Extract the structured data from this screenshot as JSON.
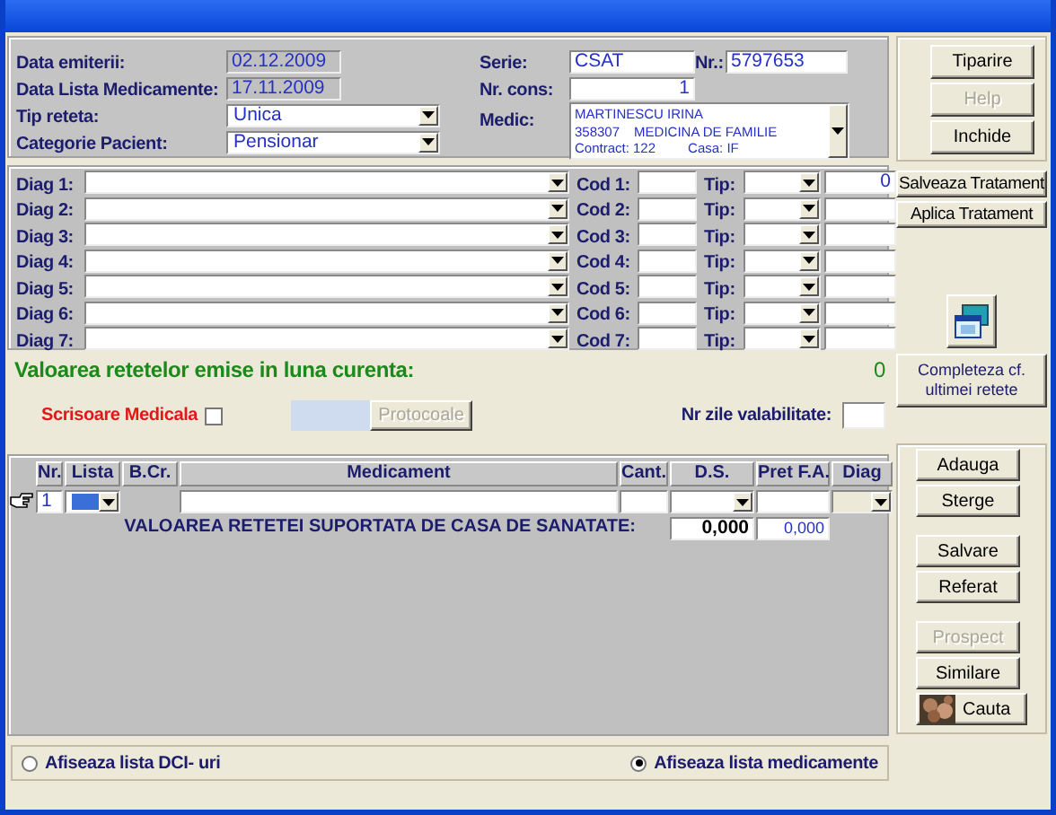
{
  "prescription": {
    "date_issued": {
      "label": "Data emiterii:",
      "value": "02.12.2009"
    },
    "date_list": {
      "label": "Data Lista Medicamente:",
      "value": "17.11.2009"
    },
    "type": {
      "label": "Tip reteta:",
      "value": "Unica"
    },
    "patient_category": {
      "label": "Categorie Pacient:",
      "value": "Pensionar"
    },
    "series": {
      "label": "Serie:",
      "value": "CSAT"
    },
    "number": {
      "label": "Nr.:",
      "value": "5797653"
    },
    "consult_no": {
      "label": "Nr. cons:",
      "value": "1"
    },
    "doctor": {
      "label": "Medic:",
      "name": "MARTINESCU IRINA",
      "code": "358307",
      "specialty": "MEDICINA DE FAMILIE",
      "contract": "Contract: 122",
      "casa": "Casa: IF"
    }
  },
  "top_buttons": [
    {
      "label": "Tiparire",
      "disabled": false
    },
    {
      "label": "Help",
      "disabled": true
    },
    {
      "label": "Inchide",
      "disabled": false
    }
  ],
  "diagnoses": [
    {
      "label": "Diag 1:",
      "code_label": "Cod 1:",
      "type_label": "Tip:",
      "value": "0"
    },
    {
      "label": "Diag 2:",
      "code_label": "Cod 2:",
      "type_label": "Tip:"
    },
    {
      "label": "Diag 3:",
      "code_label": "Cod 3:",
      "type_label": "Tip:"
    },
    {
      "label": "Diag 4:",
      "code_label": "Cod 4:",
      "type_label": "Tip:"
    },
    {
      "label": "Diag 5:",
      "code_label": "Cod 5:",
      "type_label": "Tip:"
    },
    {
      "label": "Diag 6:",
      "code_label": "Cod 6:",
      "type_label": "Tip:"
    },
    {
      "label": "Diag 7:",
      "code_label": "Cod 7:",
      "type_label": "Tip:"
    }
  ],
  "treatment_buttons": [
    "Salveaza Tratament",
    "Aplica Tratament"
  ],
  "complete_button": "Completeza cf. ultimei retete",
  "monthly_total": {
    "label": "Valoarea retetelor emise in luna curenta:",
    "value": "0"
  },
  "medical_letter": {
    "label": "Scrisoare Medicala",
    "checked": false
  },
  "protocols_button": {
    "label": "Protocoale",
    "disabled": true
  },
  "validity": {
    "label": "Nr zile valabilitate:"
  },
  "grid": {
    "columns": [
      "Nr.",
      "Lista",
      "B.Cr.",
      "Medicament",
      "Cant.",
      "D.S.",
      "Pret F.A.",
      "Diag"
    ],
    "rows": [
      {
        "nr": "1"
      }
    ],
    "total_label": "VALOAREA RETETEI SUPORTATA DE CASA DE SANATATE:",
    "total": "0,000",
    "total_price": "0,000"
  },
  "grid_buttons": [
    [
      {
        "label": "Adauga",
        "disabled": false
      },
      {
        "label": "Sterge",
        "disabled": false
      }
    ],
    [
      {
        "label": "Salvare",
        "disabled": false
      },
      {
        "label": "Referat",
        "disabled": false
      }
    ],
    [
      {
        "label": "Prospect",
        "disabled": true
      },
      {
        "label": "Similare",
        "disabled": false
      },
      {
        "label": "Cauta",
        "disabled": false,
        "kind": "icon"
      }
    ]
  ],
  "list_mode": [
    {
      "label": "Afiseaza lista DCI- uri",
      "selected": false
    },
    {
      "label": "Afiseaza lista medicamente",
      "selected": true
    }
  ]
}
